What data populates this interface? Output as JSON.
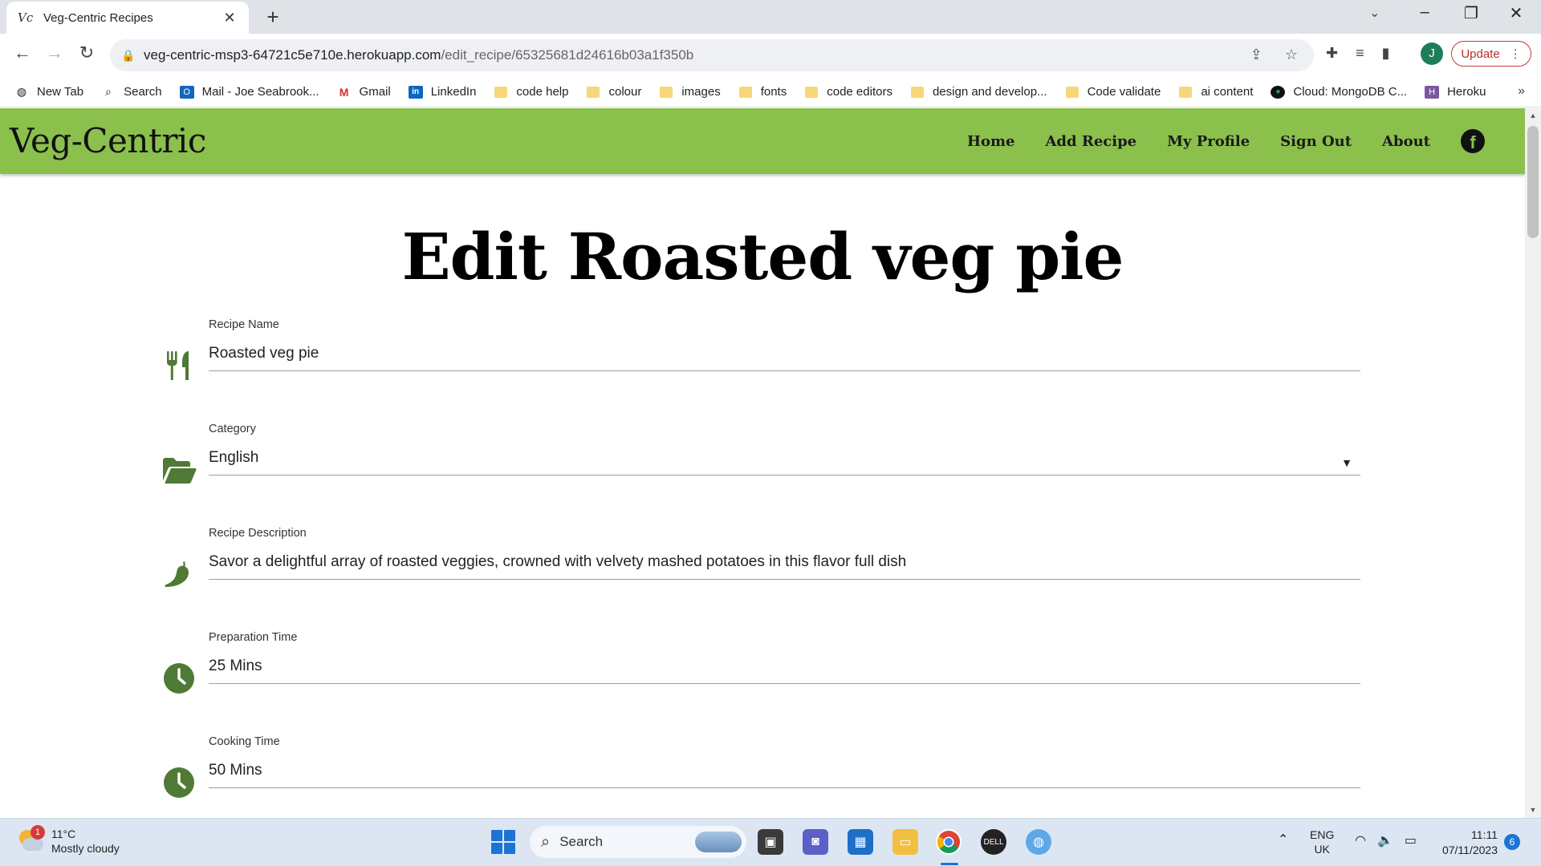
{
  "browser": {
    "tab_title": "Veg-Centric Recipes",
    "favicon_text": "Vc",
    "url_host": "veg-centric-msp3-64721c5e710e.herokuapp.com",
    "url_path": "/edit_recipe/65325681d24616b03a1f350b",
    "profile_initial": "J",
    "update_label": "Update",
    "bookmarks": [
      {
        "label": "New Tab",
        "icon": "globe-icon"
      },
      {
        "label": "Search",
        "icon": "search-icon"
      },
      {
        "label": "Mail - Joe Seabrook...",
        "icon": "outlook-icon"
      },
      {
        "label": "Gmail",
        "icon": "gmail-icon"
      },
      {
        "label": "LinkedIn",
        "icon": "linkedin-icon"
      },
      {
        "label": "code help",
        "icon": "folder-icon"
      },
      {
        "label": "colour",
        "icon": "folder-icon"
      },
      {
        "label": "images",
        "icon": "folder-icon"
      },
      {
        "label": "fonts",
        "icon": "folder-icon"
      },
      {
        "label": "code editors",
        "icon": "folder-icon"
      },
      {
        "label": "design and develop...",
        "icon": "folder-icon"
      },
      {
        "label": "Code validate",
        "icon": "folder-icon"
      },
      {
        "label": "ai content",
        "icon": "folder-icon"
      },
      {
        "label": "Cloud: MongoDB C...",
        "icon": "mongodb-icon"
      },
      {
        "label": "Heroku",
        "icon": "heroku-icon"
      }
    ]
  },
  "site": {
    "brand": "Veg-Centric",
    "nav": [
      "Home",
      "Add Recipe",
      "My Profile",
      "Sign Out",
      "About"
    ],
    "accent_color": "#8bc04d",
    "icon_color": "#4f7a36"
  },
  "page": {
    "title": "Edit Roasted veg pie",
    "fields": [
      {
        "label": "Recipe Name",
        "value": "Roasted veg pie",
        "icon": "utensils-icon"
      },
      {
        "label": "Category",
        "value": "English",
        "icon": "folder-open-icon"
      },
      {
        "label": "Recipe Description",
        "value": "Savor a delightful array of roasted veggies, crowned with velvety mashed potatoes in this flavor full dish",
        "icon": "pepper-icon"
      },
      {
        "label": "Preparation Time",
        "value": "25 Mins",
        "icon": "clock-icon"
      },
      {
        "label": "Cooking Time",
        "value": "50 Mins",
        "icon": "clock-icon"
      }
    ]
  },
  "taskbar": {
    "weather_badge": "1",
    "temperature": "11°C",
    "weather": "Mostly cloudy",
    "search_label": "Search",
    "lang_top": "ENG",
    "lang_bottom": "UK",
    "time": "11:11",
    "date": "07/11/2023",
    "notification_count": "6"
  }
}
